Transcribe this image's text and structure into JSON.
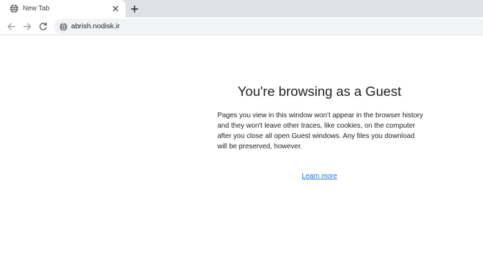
{
  "tab": {
    "title": "New Tab",
    "favicon": "globe-icon"
  },
  "toolbar": {
    "back_icon": "arrow-left-icon",
    "forward_icon": "arrow-right-icon",
    "reload_icon": "reload-icon",
    "url": "abrish.nodisk.ir",
    "site_icon": "globe-icon"
  },
  "page": {
    "title": "You're browsing as a Guest",
    "description": "Pages you view in this window won't appear in the browser history and they won't leave other traces, like cookies, on the computer after you close all open Guest windows. Any files you download will be preserved, however.",
    "learn_more_label": "Learn more"
  },
  "colors": {
    "tabstrip_bg": "#dee1e6",
    "omnibox_bg": "#f1f3f4",
    "link": "#1a73e8",
    "text": "#202124",
    "icon": "#5f6368"
  }
}
